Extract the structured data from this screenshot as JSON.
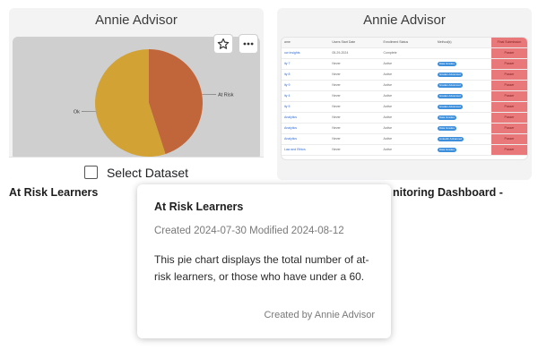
{
  "cards": [
    {
      "header": "Annie Advisor",
      "select_label": "Select Dataset",
      "title": "At Risk Learners",
      "pie": {
        "slices": [
          {
            "label": "At Risk",
            "value": 45,
            "color": "#c0663a"
          },
          {
            "label": "Ok",
            "value": 55,
            "color": "#d3a235"
          }
        ]
      }
    },
    {
      "header": "Annie Advisor",
      "title": "nitoring Dashboard -",
      "table": {
        "headers": [
          "ame",
          "Users Start Date",
          "Enrollment Status",
          "Method(s)",
          "Final Submission"
        ],
        "rows": [
          [
            "ow Insights",
            "05-29-2024",
            "Complete",
            "",
            "Passer"
          ],
          [
            "ity 7",
            "Never",
            "Active",
            "Data Grades",
            "Passer"
          ],
          [
            "ity 8",
            "Never",
            "Active",
            "Grades Advanced",
            "Passer"
          ],
          [
            "ity 9",
            "Never",
            "Active",
            "Grades Advanced",
            "Passer"
          ],
          [
            "ity 4",
            "Never",
            "Active",
            "Grades Advanced",
            "Passer"
          ],
          [
            "ity 5",
            "Never",
            "Active",
            "Grades Advanced",
            "Passer"
          ],
          [
            "Analytics",
            "Never",
            "Active",
            "Data Grades",
            "Passer"
          ],
          [
            "Analytics",
            "Never",
            "Active",
            "Data Grades",
            "Passer"
          ],
          [
            "Analytics",
            "Never",
            "Active",
            "Linkedin Advanced",
            "Passer"
          ],
          [
            "Law and Ethics",
            "Never",
            "Active",
            "Data Grades",
            "Passer"
          ]
        ]
      }
    }
  ],
  "tooltip": {
    "title": "At Risk Learners",
    "meta": "Created 2024-07-30  Modified 2024-08-12",
    "description": "This pie chart displays the total number of at-risk learners, or those who have under a 60.",
    "credit": "Created by Annie Advisor"
  },
  "icons": {
    "star": "star-icon",
    "more": "more-icon"
  }
}
